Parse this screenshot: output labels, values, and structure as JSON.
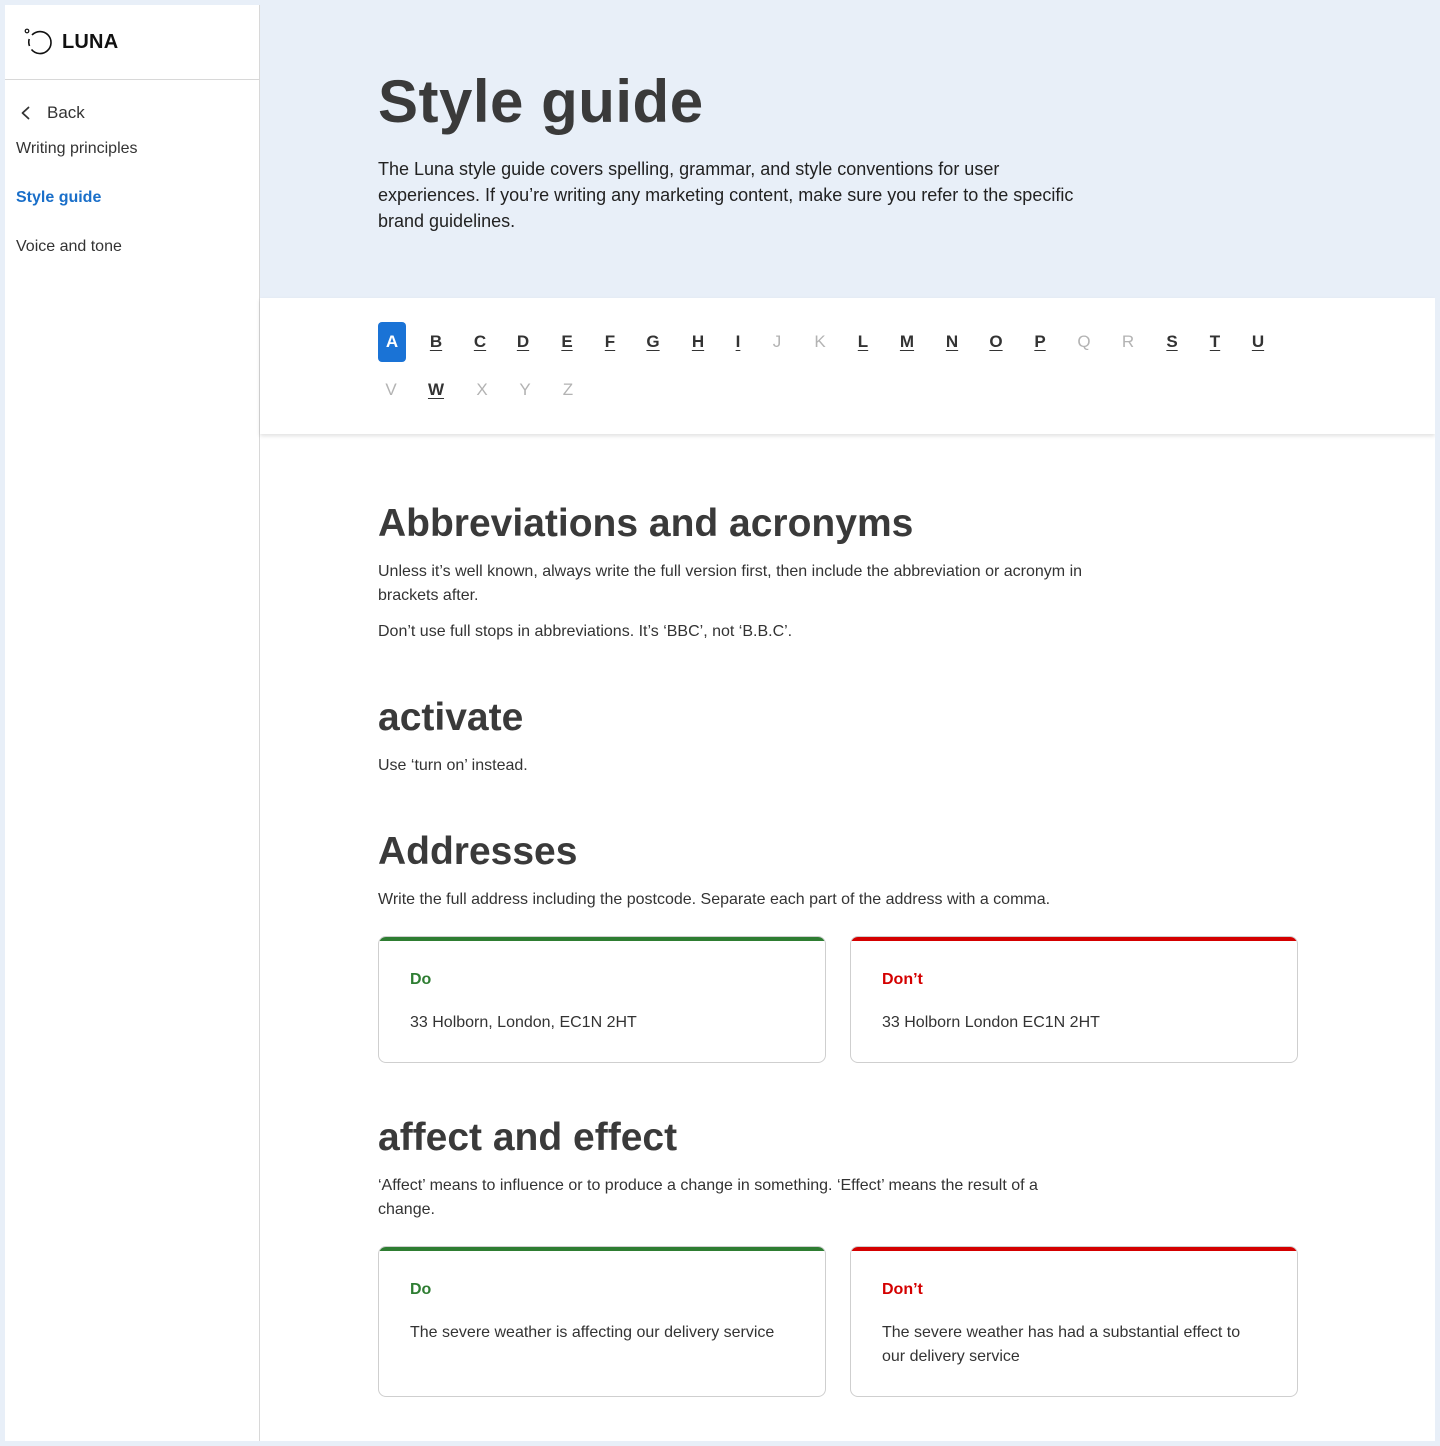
{
  "brand": {
    "name": "LUNA"
  },
  "sidebar": {
    "back_label": "Back",
    "items": [
      {
        "label": "Writing principles",
        "active": false
      },
      {
        "label": "Style guide",
        "active": true
      },
      {
        "label": "Voice and tone",
        "active": false
      }
    ]
  },
  "hero": {
    "title": "Style guide",
    "intro": "The Luna style guide covers spelling, grammar, and style conventions for user experiences. If you’re writing any marketing content, make sure you refer to the specific brand guidelines."
  },
  "alphabet": {
    "letters": [
      {
        "char": "A",
        "state": "active"
      },
      {
        "char": "B",
        "state": "link"
      },
      {
        "char": "C",
        "state": "link"
      },
      {
        "char": "D",
        "state": "link"
      },
      {
        "char": "E",
        "state": "link"
      },
      {
        "char": "F",
        "state": "link"
      },
      {
        "char": "G",
        "state": "link"
      },
      {
        "char": "H",
        "state": "link"
      },
      {
        "char": "I",
        "state": "link"
      },
      {
        "char": "J",
        "state": "disabled"
      },
      {
        "char": "K",
        "state": "disabled"
      },
      {
        "char": "L",
        "state": "link"
      },
      {
        "char": "M",
        "state": "link"
      },
      {
        "char": "N",
        "state": "link"
      },
      {
        "char": "O",
        "state": "link"
      },
      {
        "char": "P",
        "state": "link"
      },
      {
        "char": "Q",
        "state": "disabled"
      },
      {
        "char": "R",
        "state": "disabled"
      },
      {
        "char": "S",
        "state": "link"
      },
      {
        "char": "T",
        "state": "link"
      },
      {
        "char": "U",
        "state": "link"
      },
      {
        "char": "V",
        "state": "disabled"
      },
      {
        "char": "W",
        "state": "link"
      },
      {
        "char": "X",
        "state": "disabled"
      },
      {
        "char": "Y",
        "state": "disabled"
      },
      {
        "char": "Z",
        "state": "disabled"
      }
    ]
  },
  "entries": {
    "abbreviations": {
      "title": "Abbreviations and acronyms",
      "p1": "Unless it’s well known, always write the full version first, then include the abbreviation or acronym in brackets after.",
      "p2": "Don’t use full stops in abbreviations. It’s ‘BBC’, not ‘B.B.C’."
    },
    "activate": {
      "title": "activate",
      "p1": "Use ‘turn on’ instead."
    },
    "addresses": {
      "title": "Addresses",
      "p1": "Write the full address including the postcode. Separate each part of the address with a comma.",
      "do_title": "Do",
      "do_text": "33 Holborn, London, EC1N 2HT",
      "dont_title": "Don’t",
      "dont_text": "33 Holborn London EC1N 2HT"
    },
    "affect": {
      "title": "affect and effect",
      "p1": "‘Affect’ means to influence or to produce a change in something. ‘Effect’ means the result of a change.",
      "do_title": "Do",
      "do_text": "The severe weather is affecting our delivery service",
      "dont_title": "Don’t",
      "dont_text": "The severe weather has had a substantial effect to our delivery service"
    }
  },
  "colors": {
    "accent": "#1a73d6",
    "do": "#2e7d32",
    "dont": "#d40000",
    "hero_bg": "#e8eff8"
  },
  "icons": {
    "logo": "luna-logo-icon",
    "back": "chevron-left-icon"
  }
}
